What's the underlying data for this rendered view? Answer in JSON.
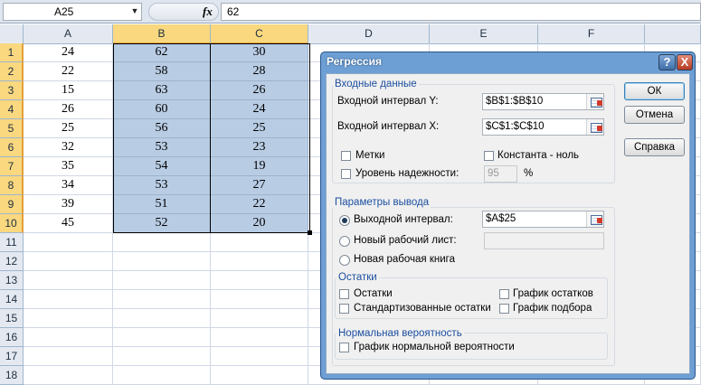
{
  "formula_bar": {
    "name_box": "A25",
    "fx_label": "fx",
    "value": "62"
  },
  "sheet": {
    "columns": [
      "A",
      "B",
      "C",
      "D",
      "E",
      "F"
    ],
    "rows": [
      "1",
      "2",
      "3",
      "4",
      "5",
      "6",
      "7",
      "8",
      "9",
      "10",
      "11",
      "12",
      "13",
      "14",
      "15",
      "16",
      "17",
      "18"
    ],
    "data": [
      [
        "24",
        "62",
        "30"
      ],
      [
        "22",
        "58",
        "28"
      ],
      [
        "15",
        "63",
        "26"
      ],
      [
        "26",
        "60",
        "24"
      ],
      [
        "25",
        "56",
        "25"
      ],
      [
        "32",
        "53",
        "23"
      ],
      [
        "35",
        "54",
        "19"
      ],
      [
        "34",
        "53",
        "27"
      ],
      [
        "39",
        "51",
        "22"
      ],
      [
        "45",
        "52",
        "20"
      ]
    ]
  },
  "dialog": {
    "title": "Регрессия",
    "help": "?",
    "close": "X",
    "input_group": "Входные данные",
    "y_label": "Входной интервал Y:",
    "y_value": "$B$1:$B$10",
    "x_label": "Входной интервал X:",
    "x_value": "$C$1:$C$10",
    "labels_check": "Метки",
    "const_zero_check": "Константа - ноль",
    "confidence_check": "Уровень надежности:",
    "confidence_value": "95",
    "percent": "%",
    "output_group": "Параметры вывода",
    "output_range_radio": "Выходной интервал:",
    "output_range_value": "$A$25",
    "new_sheet_radio": "Новый рабочий лист:",
    "new_sheet_value": "",
    "new_book_radio": "Новая рабочая книга",
    "residuals_group": "Остатки",
    "residuals_check": "Остатки",
    "std_residuals_check": "Стандартизованные остатки",
    "residual_plot_check": "График остатков",
    "fit_plot_check": "График подбора",
    "normal_group": "Нормальная вероятность",
    "normal_plot_check": "График нормальной вероятности",
    "ok": "ОК",
    "cancel": "Отмена",
    "help_button": "Справка"
  }
}
